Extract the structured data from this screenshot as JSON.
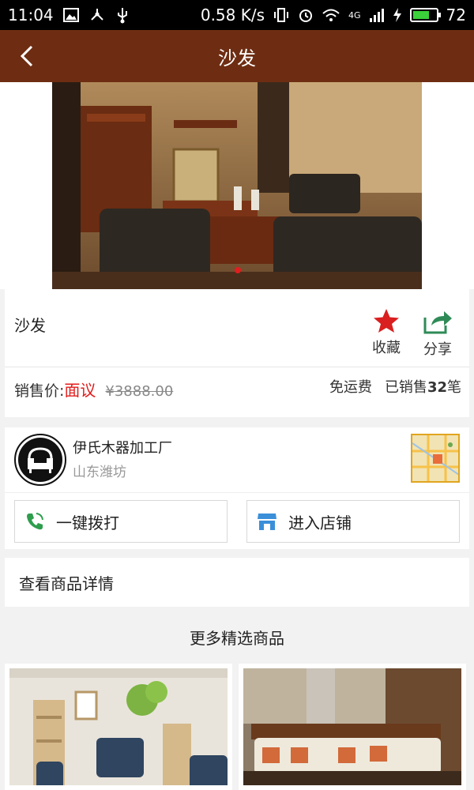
{
  "status_bar": {
    "time": "11:04",
    "speed": "0.58 K/s",
    "network": "4G",
    "battery": "72",
    "battery_level": 0.72
  },
  "header": {
    "title": "沙发"
  },
  "hero": {
    "slide_count": 1
  },
  "product": {
    "name": "沙发",
    "favorite_label": "收藏",
    "share_label": "分享",
    "price_label": "销售价:",
    "price_value": "面议",
    "original_price": "¥3888.00",
    "shipping": "免运费",
    "sold_prefix": "已销售",
    "sold_count": "32",
    "sold_suffix": "笔"
  },
  "store": {
    "name": "伊氏木器加工厂",
    "location": "山东潍坊",
    "call_label": "一键拨打",
    "shop_label": "进入店铺"
  },
  "detail_link": "查看商品详情",
  "more_title": "更多精选商品",
  "colors": {
    "header": "#6e2d12",
    "accent_red": "#e21b1b",
    "call_green": "#2e9e4d",
    "shop_blue": "#3b8fd9"
  }
}
